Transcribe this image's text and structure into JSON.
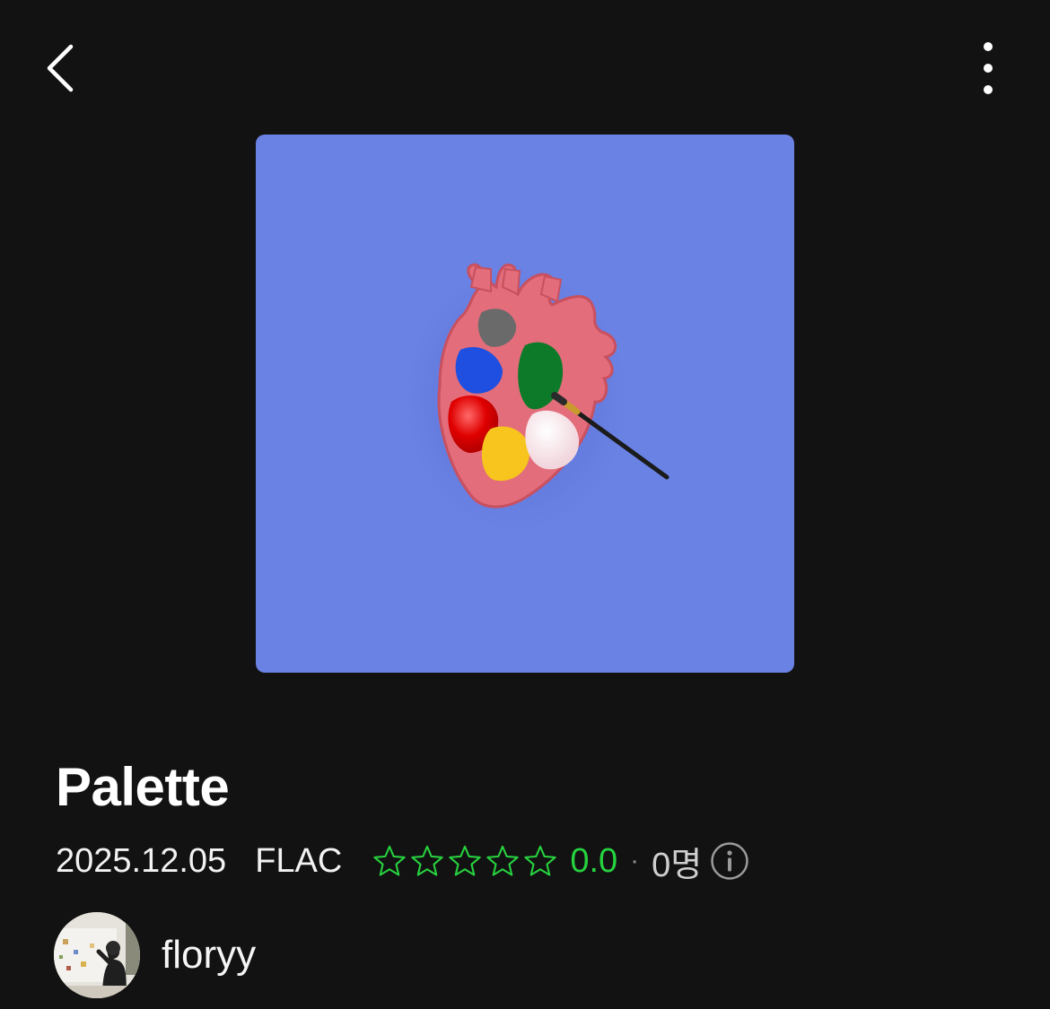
{
  "header": {
    "back_icon": "chevron-left-icon",
    "more_icon": "more-vertical-icon"
  },
  "album": {
    "title": "Palette",
    "release_date": "2025.12.05",
    "format": "FLAC",
    "cover_background": "#6a82e4",
    "rating": {
      "stars_total": 5,
      "stars_filled": 0,
      "score": "0.0",
      "separator": "·",
      "count": "0명",
      "star_color": "#27d23f"
    },
    "info_icon": "info-circle-icon"
  },
  "artist": {
    "name": "floryy",
    "avatar_icon": "artist-avatar"
  },
  "colors": {
    "background": "#121212",
    "accent": "#27d23f",
    "text": "#ffffff"
  }
}
